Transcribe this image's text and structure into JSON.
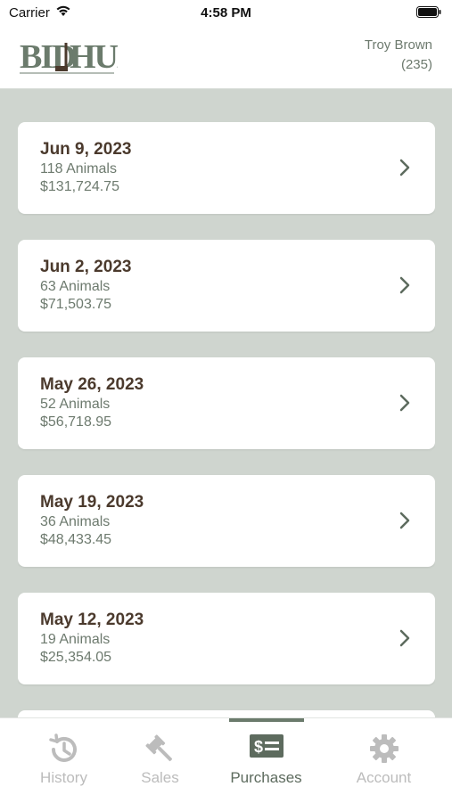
{
  "status_bar": {
    "carrier": "Carrier",
    "time": "4:58 PM"
  },
  "header": {
    "logo_text": "BIDHUB",
    "user_name": "Troy Brown",
    "user_id": "(235)"
  },
  "purchases": [
    {
      "date": "Jun 9, 2023",
      "animals": "118 Animals",
      "total": "$131,724.75"
    },
    {
      "date": "Jun 2, 2023",
      "animals": "63 Animals",
      "total": "$71,503.75"
    },
    {
      "date": "May 26, 2023",
      "animals": "52 Animals",
      "total": "$56,718.95"
    },
    {
      "date": "May 19, 2023",
      "animals": "36 Animals",
      "total": "$48,433.45"
    },
    {
      "date": "May 12, 2023",
      "animals": "19 Animals",
      "total": "$25,354.05"
    }
  ],
  "tabs": [
    {
      "label": "History",
      "icon": "history-icon",
      "active": false
    },
    {
      "label": "Sales",
      "icon": "gavel-icon",
      "active": false
    },
    {
      "label": "Purchases",
      "icon": "money-icon",
      "active": true
    },
    {
      "label": "Account",
      "icon": "gear-icon",
      "active": false
    }
  ],
  "colors": {
    "background": "#cfd5cf",
    "accent": "#5d6b5e",
    "date_text": "#4b3a2d",
    "inactive_tab": "#bcbcbc"
  }
}
